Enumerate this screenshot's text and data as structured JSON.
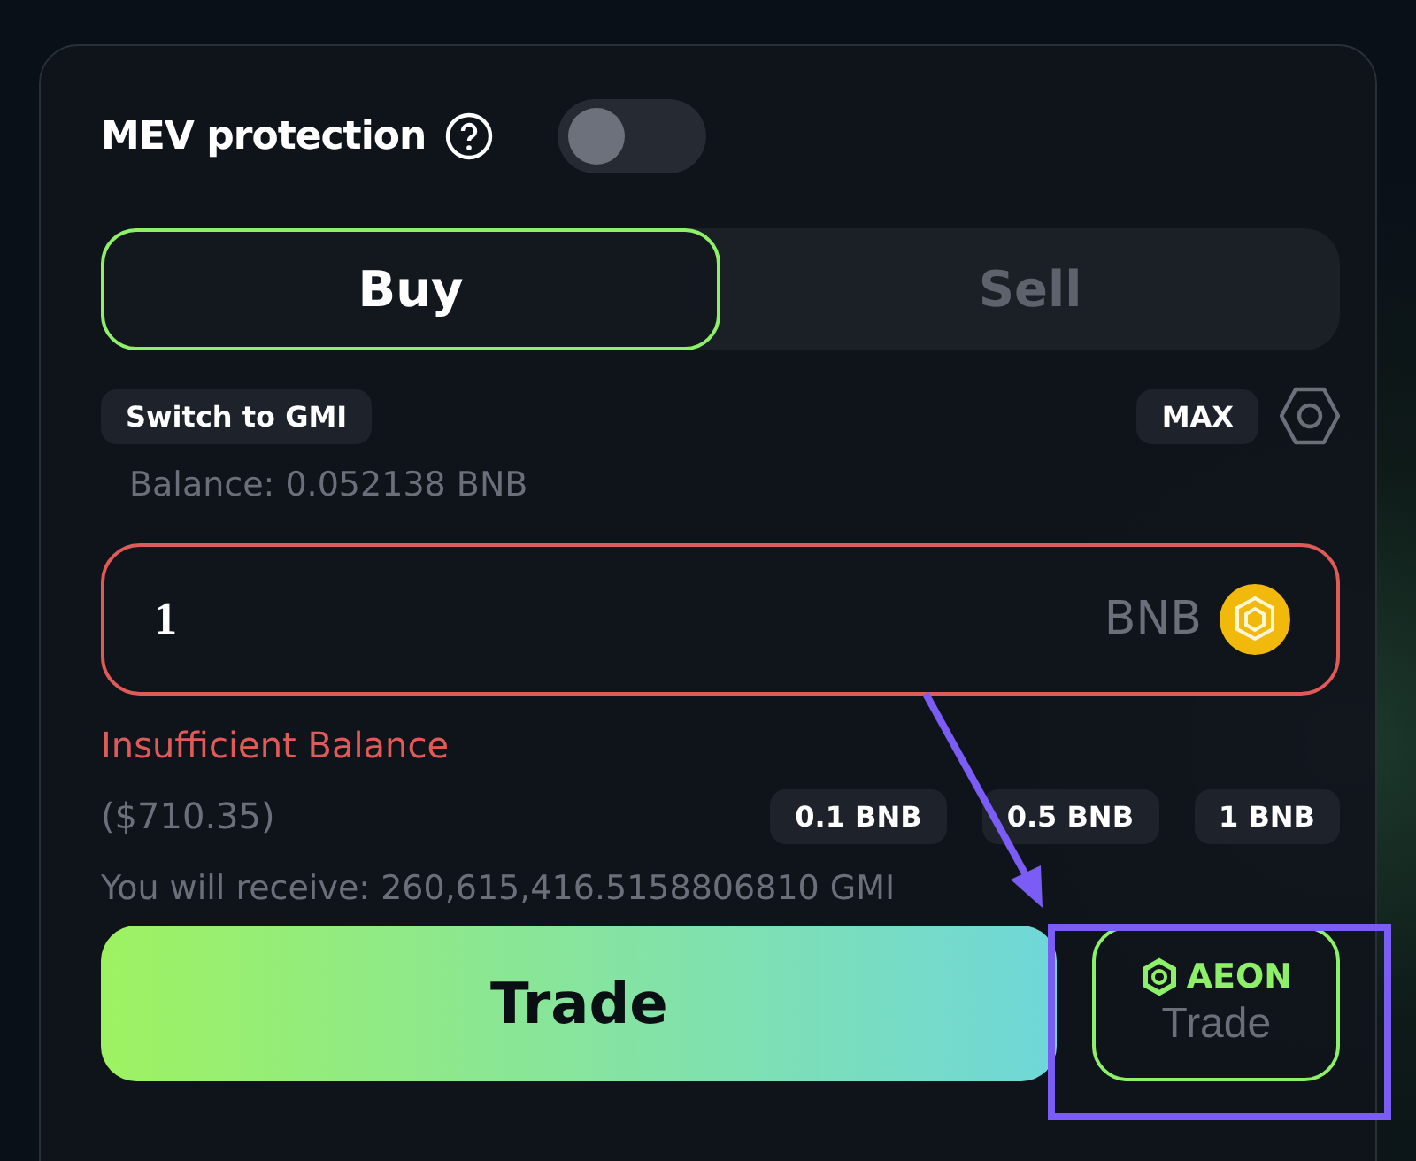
{
  "mev": {
    "label": "MEV protection",
    "on": false
  },
  "tabs": [
    {
      "label": "Buy",
      "selected": true
    },
    {
      "label": "Sell",
      "selected": false
    }
  ],
  "switch_button": "Switch to GMI",
  "max_button": "MAX",
  "balance": "Balance: 0.052138 BNB",
  "amount": {
    "value": "1",
    "token": "BNB",
    "error": true
  },
  "error_text": "Insufficient Balance",
  "usd_value": "($710.35)",
  "presets": [
    "0.1 BNB",
    "0.5 BNB",
    "1 BNB"
  ],
  "receive": "You will receive: 260,615,416.5158806810 GMI",
  "trade_button": "Trade",
  "aeon_button": {
    "brand": "AEON",
    "label": "Trade"
  }
}
